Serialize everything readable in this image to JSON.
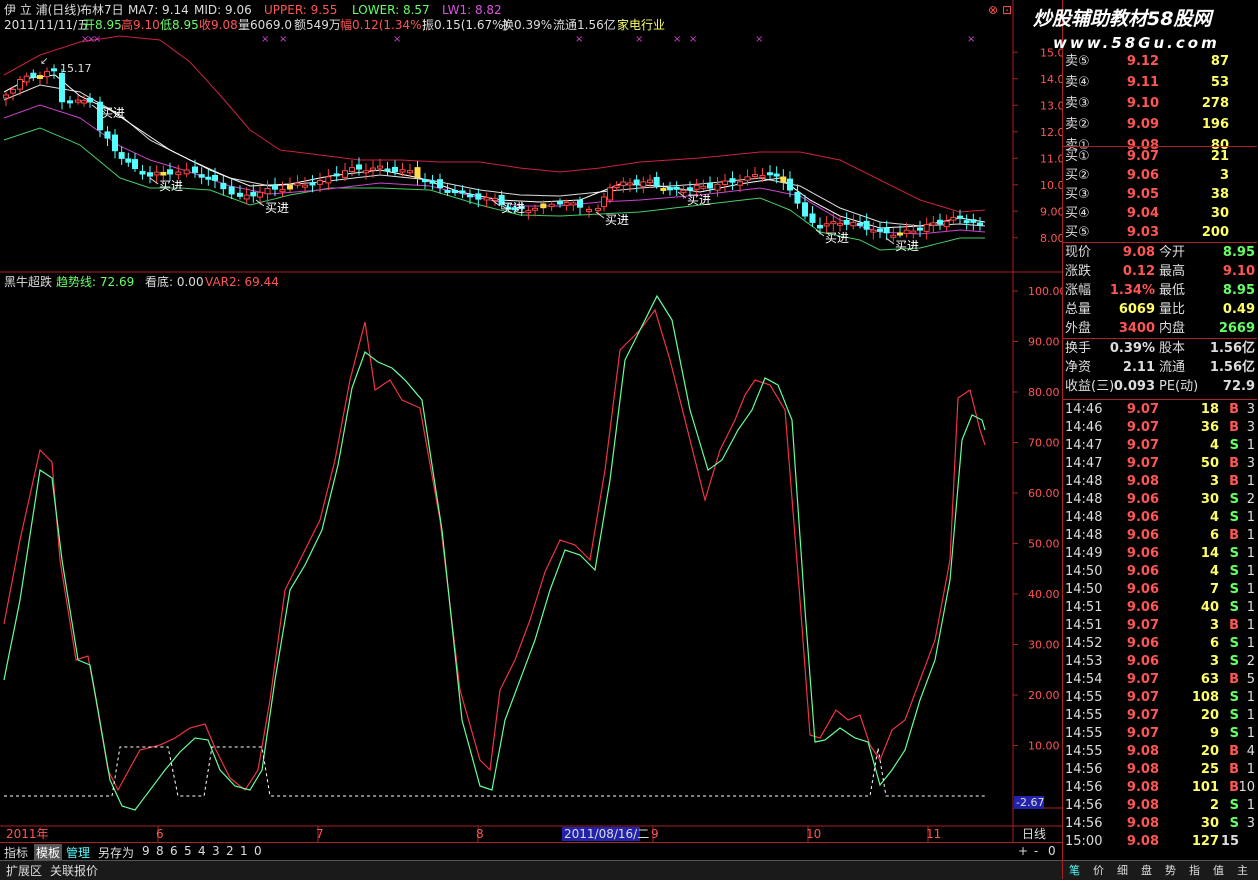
{
  "upper_legend": {
    "name": "伊 立 浦(日线)",
    "indicator": "布林7日",
    "ma7": "MA7: 9.14",
    "mid": "MID: 9.06",
    "upper": "UPPER: 9.55",
    "lower": "LOWER: 8.57",
    "lw1": "LW1: 8.82"
  },
  "quote_line": {
    "date": "2011/11/11/五",
    "open": "开8.95",
    "high": "高9.10",
    "low": "低8.95",
    "close": "收9.08",
    "volume": "量6069.0",
    "amount": "额549万",
    "change": "幅0.12(1.34%)",
    "amplitude": "振0.15(1.67%)",
    "turnover": "换0.39%",
    "float": "流通1.56亿",
    "industry": "家电行业"
  },
  "price_annotation": "15.17",
  "buy_label": "买进",
  "upper_axis": [
    "15.00",
    "14.00",
    "13.00",
    "12.00",
    "11.00",
    "10.00",
    "9.00",
    "8.00"
  ],
  "lower_legend": {
    "name": "黑牛超跌",
    "trend": "趋势线: 72.69",
    "bottom": "看底: 0.00",
    "var2": "VAR2: 69.44"
  },
  "lower_axis": [
    "100.00",
    "90.00",
    "80.00",
    "70.00",
    "60.00",
    "50.00",
    "40.00",
    "30.00",
    "20.00",
    "10.00"
  ],
  "lower_axis_value": "-2.67",
  "x_axis": {
    "year": "2011年",
    "months": [
      "6",
      "7",
      "8",
      "9",
      "10",
      "11"
    ],
    "cursor_date": "2011/08/16/二",
    "period": "日线"
  },
  "window_buttons": [
    "+",
    "-",
    "0"
  ],
  "bottom_tabs": {
    "indicator": "指标",
    "template": "模板",
    "manage": "管理",
    "save_as": "另存为",
    "digits": [
      "9",
      "8",
      "6",
      "5",
      "4",
      "3",
      "2",
      "1",
      "0"
    ]
  },
  "status_tabs": [
    "扩展区",
    "关联报价"
  ],
  "right_bottom_tabs": [
    "笔",
    "价",
    "细",
    "盘",
    "势",
    "指",
    "值",
    "主"
  ],
  "watermark": {
    "title": "炒股辅助教材58股网",
    "url": "www.58Gu.com"
  },
  "order_book": {
    "sell": [
      {
        "label": "卖⑤",
        "price": "9.12",
        "vol": "87"
      },
      {
        "label": "卖④",
        "price": "9.11",
        "vol": "53"
      },
      {
        "label": "卖③",
        "price": "9.10",
        "vol": "278"
      },
      {
        "label": "卖②",
        "price": "9.09",
        "vol": "196"
      },
      {
        "label": "卖①",
        "price": "9.08",
        "vol": "80"
      }
    ],
    "buy": [
      {
        "label": "买①",
        "price": "9.07",
        "vol": "21"
      },
      {
        "label": "买②",
        "price": "9.06",
        "vol": "3"
      },
      {
        "label": "买③",
        "price": "9.05",
        "vol": "38"
      },
      {
        "label": "买④",
        "price": "9.04",
        "vol": "30"
      },
      {
        "label": "买⑤",
        "price": "9.03",
        "vol": "200"
      }
    ]
  },
  "quote_stats": [
    {
      "l1": "现价",
      "v1": "9.08",
      "l2": "今开",
      "v2": "8.95",
      "c1": "#ff5555",
      "c2": "#66ff66"
    },
    {
      "l1": "涨跌",
      "v1": "0.12",
      "l2": "最高",
      "v2": "9.10",
      "c1": "#ff5555",
      "c2": "#ff5555"
    },
    {
      "l1": "涨幅",
      "v1": "1.34%",
      "l2": "最低",
      "v2": "8.95",
      "c1": "#ff5555",
      "c2": "#66ff66"
    },
    {
      "l1": "总量",
      "v1": "6069",
      "l2": "量比",
      "v2": "0.49",
      "c1": "#ffff66",
      "c2": "#ffff66"
    },
    {
      "l1": "外盘",
      "v1": "3400",
      "l2": "内盘",
      "v2": "2669",
      "c1": "#ff5555",
      "c2": "#66ff66"
    },
    {
      "l1": "换手",
      "v1": "0.39%",
      "l2": "股本",
      "v2": "1.56亿",
      "c1": "#dddddd",
      "c2": "#dddddd"
    },
    {
      "l1": "净资",
      "v1": "2.11",
      "l2": "流通",
      "v2": "1.56亿",
      "c1": "#dddddd",
      "c2": "#dddddd"
    },
    {
      "l1": "收益(三)",
      "v1": "0.093",
      "l2": "PE(动)",
      "v2": "72.9",
      "c1": "#dddddd",
      "c2": "#dddddd"
    }
  ],
  "ticks": [
    {
      "time": "14:46",
      "price": "9.07",
      "vol": "18",
      "bs": "B",
      "n": "3"
    },
    {
      "time": "14:46",
      "price": "9.07",
      "vol": "36",
      "bs": "B",
      "n": "3"
    },
    {
      "time": "14:47",
      "price": "9.07",
      "vol": "4",
      "bs": "S",
      "n": "1"
    },
    {
      "time": "14:47",
      "price": "9.07",
      "vol": "50",
      "bs": "B",
      "n": "3"
    },
    {
      "time": "14:48",
      "price": "9.08",
      "vol": "3",
      "bs": "B",
      "n": "1"
    },
    {
      "time": "14:48",
      "price": "9.06",
      "vol": "30",
      "bs": "S",
      "n": "2"
    },
    {
      "time": "14:48",
      "price": "9.06",
      "vol": "4",
      "bs": "S",
      "n": "1"
    },
    {
      "time": "14:48",
      "price": "9.06",
      "vol": "6",
      "bs": "B",
      "n": "1"
    },
    {
      "time": "14:49",
      "price": "9.06",
      "vol": "14",
      "bs": "S",
      "n": "1"
    },
    {
      "time": "14:50",
      "price": "9.06",
      "vol": "4",
      "bs": "S",
      "n": "1"
    },
    {
      "time": "14:50",
      "price": "9.06",
      "vol": "7",
      "bs": "S",
      "n": "1"
    },
    {
      "time": "14:51",
      "price": "9.06",
      "vol": "40",
      "bs": "S",
      "n": "1"
    },
    {
      "time": "14:51",
      "price": "9.07",
      "vol": "3",
      "bs": "B",
      "n": "1"
    },
    {
      "time": "14:52",
      "price": "9.06",
      "vol": "6",
      "bs": "S",
      "n": "1"
    },
    {
      "time": "14:53",
      "price": "9.06",
      "vol": "3",
      "bs": "S",
      "n": "2"
    },
    {
      "time": "14:54",
      "price": "9.07",
      "vol": "63",
      "bs": "B",
      "n": "5"
    },
    {
      "time": "14:55",
      "price": "9.07",
      "vol": "108",
      "bs": "S",
      "n": "1"
    },
    {
      "time": "14:55",
      "price": "9.07",
      "vol": "20",
      "bs": "S",
      "n": "1"
    },
    {
      "time": "14:55",
      "price": "9.07",
      "vol": "9",
      "bs": "S",
      "n": "1"
    },
    {
      "time": "14:55",
      "price": "9.08",
      "vol": "20",
      "bs": "B",
      "n": "4"
    },
    {
      "time": "14:56",
      "price": "9.08",
      "vol": "25",
      "bs": "B",
      "n": "1"
    },
    {
      "time": "14:56",
      "price": "9.08",
      "vol": "101",
      "bs": "B",
      "n": "10"
    },
    {
      "time": "14:56",
      "price": "9.08",
      "vol": "2",
      "bs": "S",
      "n": "1"
    },
    {
      "time": "14:56",
      "price": "9.08",
      "vol": "30",
      "bs": "S",
      "n": "3"
    },
    {
      "time": "15:00",
      "price": "9.08",
      "vol": "127",
      "bs": "15",
      "n": ""
    }
  ],
  "colors": {
    "up": "#ff5555",
    "down": "#66ff66",
    "frame": "#aa2222",
    "cyan": "#55ffff",
    "yellow": "#ffff66"
  }
}
